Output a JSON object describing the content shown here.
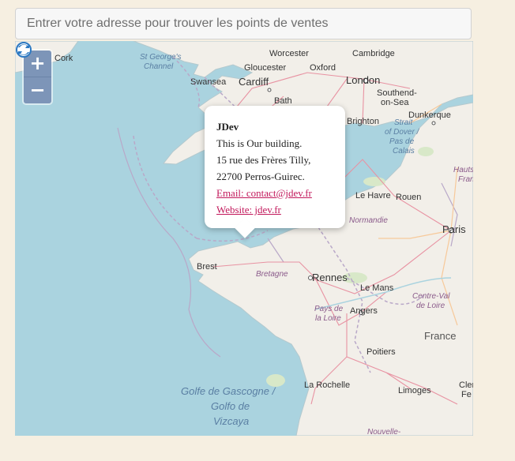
{
  "search": {
    "placeholder": "Entrer votre adresse pour trouver les points de ventes"
  },
  "zoom": {
    "in_label": "+",
    "out_label": "−"
  },
  "popup": {
    "title": "JDev",
    "line1": "This is Our building.",
    "line2": "15 rue des Frères Tilly,",
    "line3": "22700 Perros-Guirec.",
    "email": "Email: contact@jdev.fr",
    "website": "Website: jdev.fr"
  },
  "map_labels": {
    "cork": "Cork",
    "st_georges_1": "St George's",
    "st_georges_2": "Channel",
    "worcester": "Worcester",
    "cambridge": "Cambridge",
    "gloucester": "Gloucester",
    "oxford": "Oxford",
    "swansea": "Swansea",
    "cardiff": "Cardiff",
    "london": "London",
    "southend_1": "Southend-",
    "southend_2": "on-Sea",
    "bath": "Bath",
    "dunkerque": "Dunkerque",
    "brighton": "Brighton",
    "strait_1": "Strait",
    "strait_2": "of Dover /",
    "strait_3": "Pas de",
    "strait_4": "Calais",
    "hauts_1": "Hauts",
    "hauts_2": "Fran",
    "le_havre": "Le Havre",
    "rouen": "Rouen",
    "normandie": "Normandie",
    "paris": "Paris",
    "brest": "Brest",
    "bretagne": "Bretagne",
    "rennes": "Rennes",
    "le_mans": "Le Mans",
    "centre_1": "Centre-Val",
    "centre_2": "de Loire",
    "pays_1": "Pays de",
    "pays_2": "la Loire",
    "angers": "Angers",
    "france": "France",
    "poitiers": "Poitiers",
    "golfe_1": "Golfe de Gascogne /",
    "golfe_2": "Golfo de",
    "golfe_3": "Vizcaya",
    "la_rochelle": "La Rochelle",
    "limoges": "Limoges",
    "cler": "Cler",
    "fe": "Fe",
    "nouvelle": "Nouvelle-"
  },
  "colors": {
    "sea": "#aad3df",
    "land": "#f2efe9",
    "accent": "#7d95b8",
    "link": "#c2185b"
  }
}
